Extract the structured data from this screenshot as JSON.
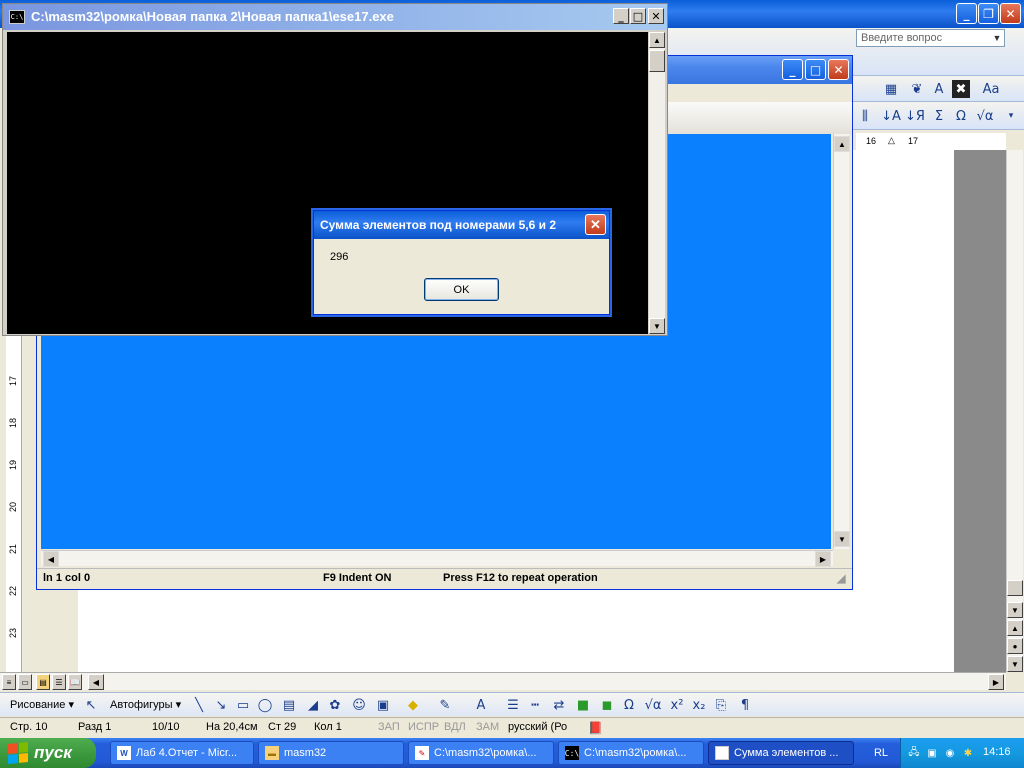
{
  "word": {
    "help_placeholder": "Введите вопрос",
    "ruler_ticks": [
      "16",
      "17"
    ],
    "vruler_ticks": [
      "17",
      "18",
      "19",
      "20",
      "21",
      "22",
      "23"
    ],
    "draw_menu": "Рисование ▾",
    "autoshapes_menu": "Автофигуры ▾",
    "status": {
      "page": "Стр. 10",
      "section": "Разд 1",
      "pages": "10/10",
      "at": "На 20,4см",
      "line": "Ст 29",
      "col": "Кол 1",
      "rec": "ЗАП",
      "trk": "ИСПР",
      "ext": "ВДЛ",
      "ovr": "ЗАМ",
      "lang": "русский (Ро"
    }
  },
  "editor": {
    "status_pos": "ln 1 col 0",
    "status_indent": "F9 Indent ON",
    "status_hint": "Press F12 to repeat operation"
  },
  "console": {
    "title": "C:\\masm32\\ромка\\Новая папка 2\\Новая папка1\\ese17.exe",
    "icon_text": "C:\\"
  },
  "msgbox": {
    "title": "Сумма элементов под номерами 5,6 и 2",
    "text": "296",
    "ok_label": "OK"
  },
  "taskbar": {
    "start_label": "пуск",
    "tasks": [
      {
        "label": "Лаб 4.Отчет - Micr..."
      },
      {
        "label": "masm32"
      },
      {
        "label": "C:\\masm32\\ромка\\..."
      },
      {
        "label": "C:\\masm32\\ромка\\..."
      },
      {
        "label": "Сумма элементов ..."
      }
    ],
    "lang": "RL",
    "clock": "14:16"
  }
}
